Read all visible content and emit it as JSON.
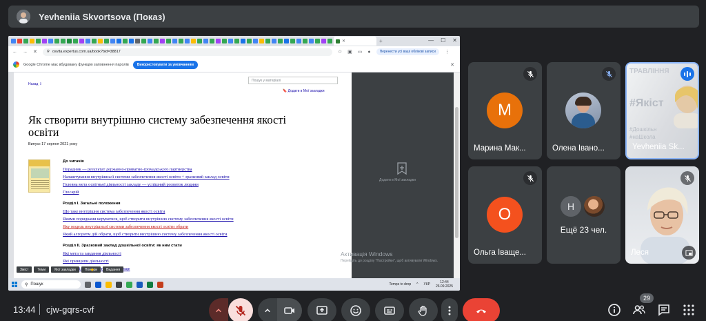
{
  "presenter": {
    "name": "Yevheniia Skvortsova (Показ)"
  },
  "shared_screen": {
    "browser": {
      "url": "osvita.expertus.com.ua/book?bid=38817",
      "profile_chip": "Перенести усі ваші облікові записи",
      "infobar_text": "Google Chrome має вбудовану функцію заповнення паролів",
      "infobar_button": "Використовувати за умовчанням"
    },
    "doc": {
      "back_link": "Назад",
      "search_placeholder": "Пошук у матеріалі",
      "bookmark_link": "Додати в Мої закладки",
      "title": "Як створити внутрішню систему забезпечення якості освіти",
      "date": "Випуск 17 серпня 2021 року",
      "toc": [
        {
          "type": "sec",
          "text": "До читачів"
        },
        {
          "type": "link",
          "text": "Порадник — результат державно-приватно-громадського партнерства"
        },
        {
          "type": "link",
          "text": "Налаштування внутрішньої системи забезпечення якості освіти + зразковий заклад освіти"
        },
        {
          "type": "link",
          "text": "Головна мета освітньої діяльності закладу — успішний розвиток людини"
        },
        {
          "type": "link",
          "text": "Глосарій"
        },
        {
          "type": "sec",
          "text": "Розділ І. Загальні положення"
        },
        {
          "type": "link",
          "text": "Що таке внутрішня система забезпечення якості освіти"
        },
        {
          "type": "link",
          "text": "Якими порядками керуватися, щоб створити внутрішню систему забезпечення якості освіти"
        },
        {
          "type": "link-red",
          "text": "Яку модель внутрішньої системи забезпечення якості освіти обрати"
        },
        {
          "type": "link",
          "text": "Який алгоритм дій обрати, щоб створити внутрішню систему забезпечення якості освіти"
        },
        {
          "type": "sec",
          "text": "Розділ ІІ. Зразковий заклад дошкільної освіти: як ним стати"
        },
        {
          "type": "link",
          "text": "Які мета та завдання діяльності"
        },
        {
          "type": "link",
          "text": "Які принципи діяльності"
        },
        {
          "type": "link",
          "text": "Як організувати освітнє середовище"
        }
      ],
      "toolbar": [
        "Зміст",
        "Теми",
        "Мої закладки",
        "Номери",
        "Видання"
      ]
    },
    "side_panel": {
      "bookmarks_label": "Додати в Мої закладки",
      "activation_title": "Активація Windows",
      "activation_sub": "Перейдіть до розділу \"Настройки\", щоб активувати Windows."
    },
    "taskbar": {
      "search": "Пошук",
      "tray_text": "Temps to drop",
      "lang": "УКР",
      "time": "12:44",
      "date": "26.09.2025"
    }
  },
  "participants": [
    {
      "name": "Марина Мак...",
      "initial": "М",
      "color": "#e8710a",
      "muted": true
    },
    {
      "name": "Олена Івано...",
      "muted": true,
      "photo": true
    },
    {
      "name": "Yevheniia Sk...",
      "speaking": true,
      "video": true
    },
    {
      "name": "Ольга Іваще...",
      "initial": "О",
      "color": "#f4511e",
      "muted": true
    },
    {
      "name": "Ещё 23 чел.",
      "more": true,
      "mini_initial": "Н"
    },
    {
      "name": "Леся",
      "muted": true,
      "video": true
    }
  ],
  "video_tile_1": {
    "line1": "ТРАВЛІННЯ",
    "line2": "#Якіст",
    "line3": "#Дошкільн",
    "line4": "#наШкола"
  },
  "meeting": {
    "time": "13:44",
    "code": "cjw-gqrs-cvf",
    "participant_count": "29"
  },
  "colors": {
    "hangup": "#ea4335",
    "mic_off": "#f9dedc",
    "accent": "#8ab4f8"
  }
}
